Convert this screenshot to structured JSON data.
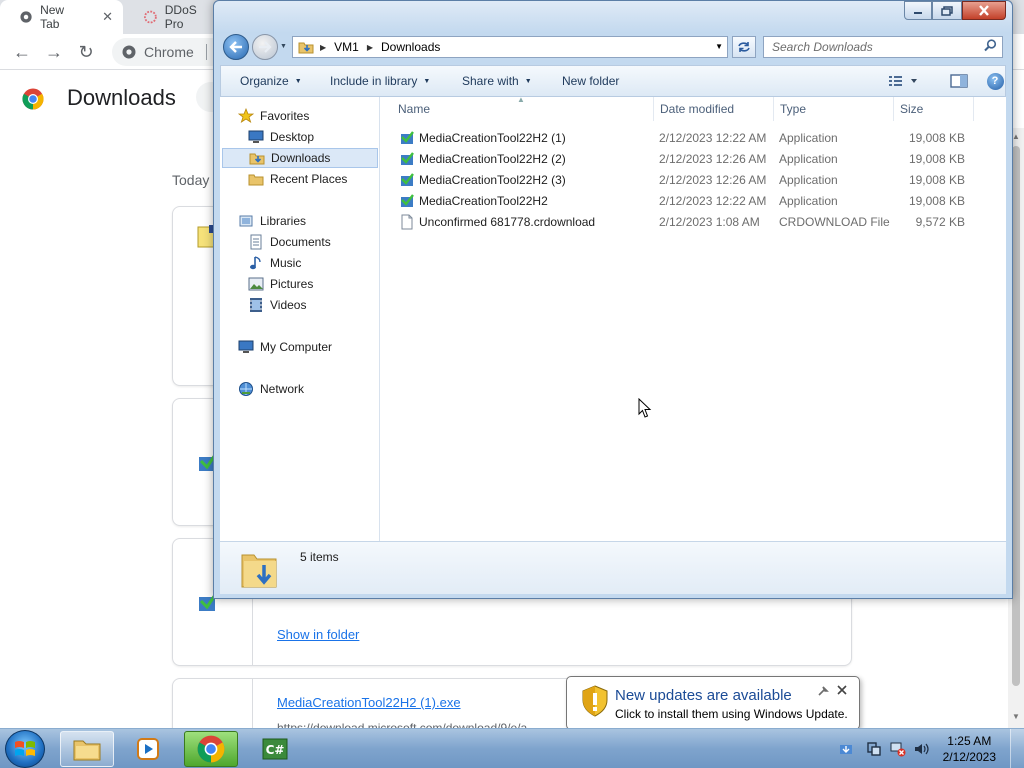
{
  "chrome": {
    "tabs": [
      {
        "label": "New Tab",
        "close": "✕"
      },
      {
        "label": "DDoS Pro"
      }
    ],
    "omnibox_text": "Chrome",
    "page_title": "Downloads",
    "section_label": "Today",
    "downloads": [
      {
        "link": "",
        "url": ""
      },
      {
        "link": "",
        "url": ""
      },
      {
        "link": "Show in folder",
        "url": ""
      },
      {
        "link": "MediaCreationTool22H2 (1).exe",
        "url": "https://download.microsoft.com/download/9/e/a..."
      }
    ]
  },
  "explorer": {
    "address": {
      "root": "VM1",
      "current": "Downloads"
    },
    "search_placeholder": "Search Downloads",
    "commands": {
      "organize": "Organize",
      "include": "Include in library",
      "share": "Share with",
      "new_folder": "New folder"
    },
    "nav": {
      "favorites": "Favorites",
      "desktop": "Desktop",
      "downloads": "Downloads",
      "recent": "Recent Places",
      "libraries": "Libraries",
      "documents": "Documents",
      "music": "Music",
      "pictures": "Pictures",
      "videos": "Videos",
      "computer": "My Computer",
      "network": "Network"
    },
    "columns": {
      "name": "Name",
      "date": "Date modified",
      "type": "Type",
      "size": "Size"
    },
    "files": [
      {
        "name": "MediaCreationTool22H2 (1)",
        "date": "2/12/2023 12:22 AM",
        "type": "Application",
        "size": "19,008 KB",
        "icon": "app-icon"
      },
      {
        "name": "MediaCreationTool22H2 (2)",
        "date": "2/12/2023 12:26 AM",
        "type": "Application",
        "size": "19,008 KB",
        "icon": "app-icon"
      },
      {
        "name": "MediaCreationTool22H2 (3)",
        "date": "2/12/2023 12:26 AM",
        "type": "Application",
        "size": "19,008 KB",
        "icon": "app-icon"
      },
      {
        "name": "MediaCreationTool22H2",
        "date": "2/12/2023 12:22 AM",
        "type": "Application",
        "size": "19,008 KB",
        "icon": "app-icon"
      },
      {
        "name": "Unconfirmed 681778.crdownload",
        "date": "2/12/2023 1:08 AM",
        "type": "CRDOWNLOAD File",
        "size": "9,572 KB",
        "icon": "blank-file-icon"
      }
    ],
    "status_count": "5 items"
  },
  "notification": {
    "title": "New updates are available",
    "body": "Click to install them using Windows Update."
  },
  "taskbar": {
    "time": "1:25 AM",
    "date": "2/12/2023",
    "pinned": [
      "windows-explorer",
      "media-player",
      "google-chrome",
      "visual-csharp"
    ]
  },
  "colors": {
    "explorer_frame": "#c3d9ef",
    "chrome_link": "#1a73e8",
    "notification_title": "#1b4b96"
  }
}
